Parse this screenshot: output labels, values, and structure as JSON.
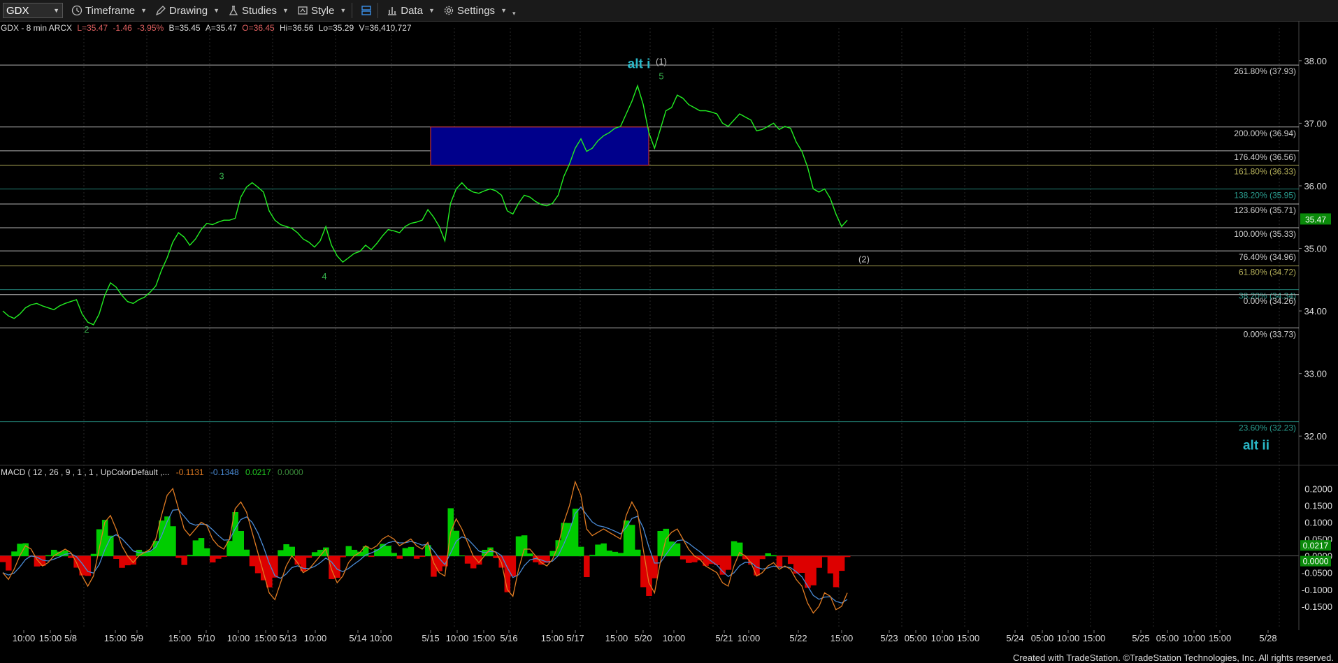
{
  "toolbar": {
    "symbol": "GDX",
    "timeframe": "Timeframe",
    "drawing": "Drawing",
    "studies": "Studies",
    "style": "Style",
    "data": "Data",
    "settings": "Settings"
  },
  "header": {
    "title": "GDX - 8 min  ARCX",
    "last": "L=35.47",
    "chg": "-1.46",
    "pct": "-3.95%",
    "bid": "B=35.45",
    "ask": "A=35.47",
    "open": "O=36.45",
    "hi": "Hi=36.56",
    "lo": "Lo=35.29",
    "vol": "V=36,410,727"
  },
  "macd_header": {
    "label": "MACD ( 12 , 26 , 9 , 1 , 1 , UpColorDefault ,...",
    "v1": "-0.1131",
    "v2": "-0.1348",
    "v3": "0.0217",
    "v4": "0.0000"
  },
  "footer": "Created with TradeStation. ©TradeStation Technologies, Inc. All rights reserved.",
  "colors": {
    "price": "#22ee22",
    "fib_white": "#cfcfcf",
    "fib_teal": "#2a9d8f",
    "fib_olive": "#b5b05a",
    "box": "#00008b",
    "box_border": "#c03030",
    "macd_orange": "#e07b22",
    "macd_blue": "#4a8bd6",
    "hist_up": "#00cc00",
    "hist_down": "#dd0000",
    "label_cyan": "#2ab8c8",
    "wave_green": "#37b24d"
  },
  "chart_data": {
    "type": "line",
    "symbol": "GDX",
    "interval": "8 min",
    "price_axis": {
      "min": 31.6,
      "max": 38.3,
      "ticks": [
        "38.00",
        "37.00",
        "36.00",
        "35.00",
        "34.00",
        "33.00",
        "32.00"
      ]
    },
    "last_price_tag": "35.47",
    "time_labels": [
      "10:00",
      "15:00",
      "5/8",
      "15:00",
      "5/9",
      "15:00",
      "5/10",
      "10:00",
      "15:00",
      "5/13",
      "10:00",
      "5/14",
      "10:00",
      "5/15",
      "10:00",
      "15:00",
      "5/16",
      "15:00",
      "5/17",
      "15:00",
      "5/20",
      "10:00",
      "5/21",
      "10:00",
      "5/22",
      "15:00",
      "5/23",
      "05:00",
      "10:00",
      "15:00",
      "5/24",
      "05:00",
      "10:00",
      "15:00",
      "5/25",
      "05:00",
      "10:00",
      "15:00",
      "5/28"
    ],
    "fib_levels": [
      {
        "label": "261.80% (37.93)",
        "value": 37.93,
        "style": "white"
      },
      {
        "label": "200.00% (36.94)",
        "value": 36.94,
        "style": "white"
      },
      {
        "label": "176.40% (36.56)",
        "value": 36.56,
        "style": "white"
      },
      {
        "label": "161.80% (36.33)",
        "value": 36.33,
        "style": "olive"
      },
      {
        "label": "138.20% (35.95)",
        "value": 35.95,
        "style": "teal"
      },
      {
        "label": "123.60% (35.71)",
        "value": 35.71,
        "style": "white"
      },
      {
        "label": "100.00% (35.33)",
        "value": 35.33,
        "style": "white"
      },
      {
        "label": "76.40% (34.96)",
        "value": 34.96,
        "style": "white"
      },
      {
        "label": "61.80% (34.72)",
        "value": 34.72,
        "style": "olive"
      },
      {
        "label": "38.20% (34.34)",
        "value": 34.34,
        "style": "teal"
      },
      {
        "label": "0.00% (34.26)",
        "value": 34.26,
        "style": "white"
      },
      {
        "label": "0.00% (33.73)",
        "value": 33.73,
        "style": "white"
      },
      {
        "label": "23.60% (32.23)",
        "value": 32.23,
        "style": "teal"
      }
    ],
    "target_box": {
      "from_time": "5/15",
      "to_time": "5/20",
      "high": 36.94,
      "low": 36.33
    },
    "wave_labels": [
      {
        "text": "2",
        "value": 33.7
      },
      {
        "text": "3",
        "value": 36.15
      },
      {
        "text": "4",
        "value": 34.55
      },
      {
        "text": "5",
        "value": 37.75
      },
      {
        "text": "(1)",
        "value": 37.98
      },
      {
        "text": "(2)",
        "value": 34.82
      },
      {
        "text": "alt i",
        "value": 37.95
      },
      {
        "text": "alt ii",
        "value": 31.85
      }
    ],
    "price_series": [
      34.0,
      33.92,
      33.88,
      33.95,
      34.05,
      34.1,
      34.12,
      34.08,
      34.05,
      34.02,
      34.08,
      34.12,
      34.15,
      34.18,
      33.95,
      33.82,
      33.78,
      33.95,
      34.25,
      34.45,
      34.38,
      34.25,
      34.15,
      34.12,
      34.18,
      34.22,
      34.3,
      34.4,
      34.65,
      34.85,
      35.1,
      35.25,
      35.18,
      35.05,
      35.15,
      35.3,
      35.4,
      35.38,
      35.42,
      35.45,
      35.45,
      35.48,
      35.82,
      35.98,
      36.05,
      35.98,
      35.9,
      35.6,
      35.45,
      35.38,
      35.35,
      35.32,
      35.25,
      35.15,
      35.1,
      35.02,
      35.12,
      35.35,
      35.05,
      34.88,
      34.78,
      34.85,
      34.92,
      34.95,
      35.05,
      34.98,
      35.08,
      35.2,
      35.3,
      35.28,
      35.25,
      35.35,
      35.4,
      35.42,
      35.45,
      35.62,
      35.5,
      35.35,
      35.12,
      35.72,
      35.95,
      36.05,
      35.95,
      35.9,
      35.88,
      35.92,
      35.95,
      35.92,
      35.85,
      35.6,
      35.55,
      35.72,
      35.85,
      35.82,
      35.75,
      35.7,
      35.68,
      35.72,
      35.85,
      36.15,
      36.35,
      36.6,
      36.75,
      36.55,
      36.6,
      36.72,
      36.8,
      36.85,
      36.92,
      36.95,
      37.15,
      37.35,
      37.6,
      37.3,
      36.85,
      36.6,
      36.9,
      37.2,
      37.25,
      37.45,
      37.4,
      37.3,
      37.25,
      37.2,
      37.2,
      37.18,
      37.15,
      37.0,
      36.95,
      37.05,
      37.15,
      37.1,
      37.05,
      36.88,
      36.9,
      36.95,
      37.0,
      36.9,
      36.95,
      36.92,
      36.7,
      36.55,
      36.3,
      35.95,
      35.9,
      35.95,
      35.8,
      35.55,
      35.35,
      35.45
    ],
    "macd_axis": {
      "min": -0.2,
      "max": 0.24,
      "ticks": [
        "0.2000",
        "0.1500",
        "0.1000",
        "0.0500",
        "0.0000",
        "-0.0500",
        "-0.1000",
        "-0.1500"
      ]
    },
    "macd_tags": [
      "0.0217",
      "0.0000"
    ],
    "macd_series": [
      -0.05,
      -0.07,
      -0.04,
      0.0,
      0.03,
      0.02,
      -0.01,
      -0.03,
      -0.02,
      0.0,
      0.01,
      0.02,
      0.01,
      -0.02,
      -0.06,
      -0.09,
      -0.06,
      0.02,
      0.1,
      0.12,
      0.08,
      0.03,
      0.0,
      -0.02,
      0.0,
      0.01,
      0.02,
      0.05,
      0.12,
      0.18,
      0.2,
      0.14,
      0.08,
      0.06,
      0.08,
      0.1,
      0.09,
      0.05,
      0.03,
      0.02,
      0.05,
      0.14,
      0.16,
      0.13,
      0.07,
      0.01,
      -0.05,
      -0.11,
      -0.13,
      -0.08,
      -0.03,
      0.0,
      -0.02,
      -0.05,
      -0.04,
      -0.02,
      0.0,
      0.02,
      -0.04,
      -0.08,
      -0.06,
      -0.02,
      0.0,
      0.01,
      0.03,
      0.02,
      0.03,
      0.05,
      0.06,
      0.05,
      0.03,
      0.04,
      0.05,
      0.03,
      0.02,
      0.04,
      -0.02,
      -0.05,
      -0.06,
      0.07,
      0.11,
      0.08,
      0.04,
      0.0,
      -0.02,
      0.0,
      0.02,
      0.01,
      -0.02,
      -0.1,
      -0.12,
      -0.04,
      0.02,
      0.02,
      0.0,
      -0.02,
      -0.03,
      -0.01,
      0.03,
      0.1,
      0.15,
      0.22,
      0.18,
      0.08,
      0.06,
      0.07,
      0.08,
      0.07,
      0.06,
      0.05,
      0.12,
      0.16,
      0.13,
      0.02,
      -0.08,
      -0.11,
      -0.02,
      0.05,
      0.07,
      0.08,
      0.05,
      0.02,
      0.0,
      -0.01,
      -0.03,
      -0.04,
      -0.05,
      -0.08,
      -0.09,
      -0.03,
      0.01,
      0.0,
      -0.02,
      -0.06,
      -0.05,
      -0.03,
      -0.02,
      -0.04,
      -0.03,
      -0.04,
      -0.07,
      -0.09,
      -0.14,
      -0.17,
      -0.15,
      -0.11,
      -0.12,
      -0.16,
      -0.15,
      -0.11
    ]
  }
}
